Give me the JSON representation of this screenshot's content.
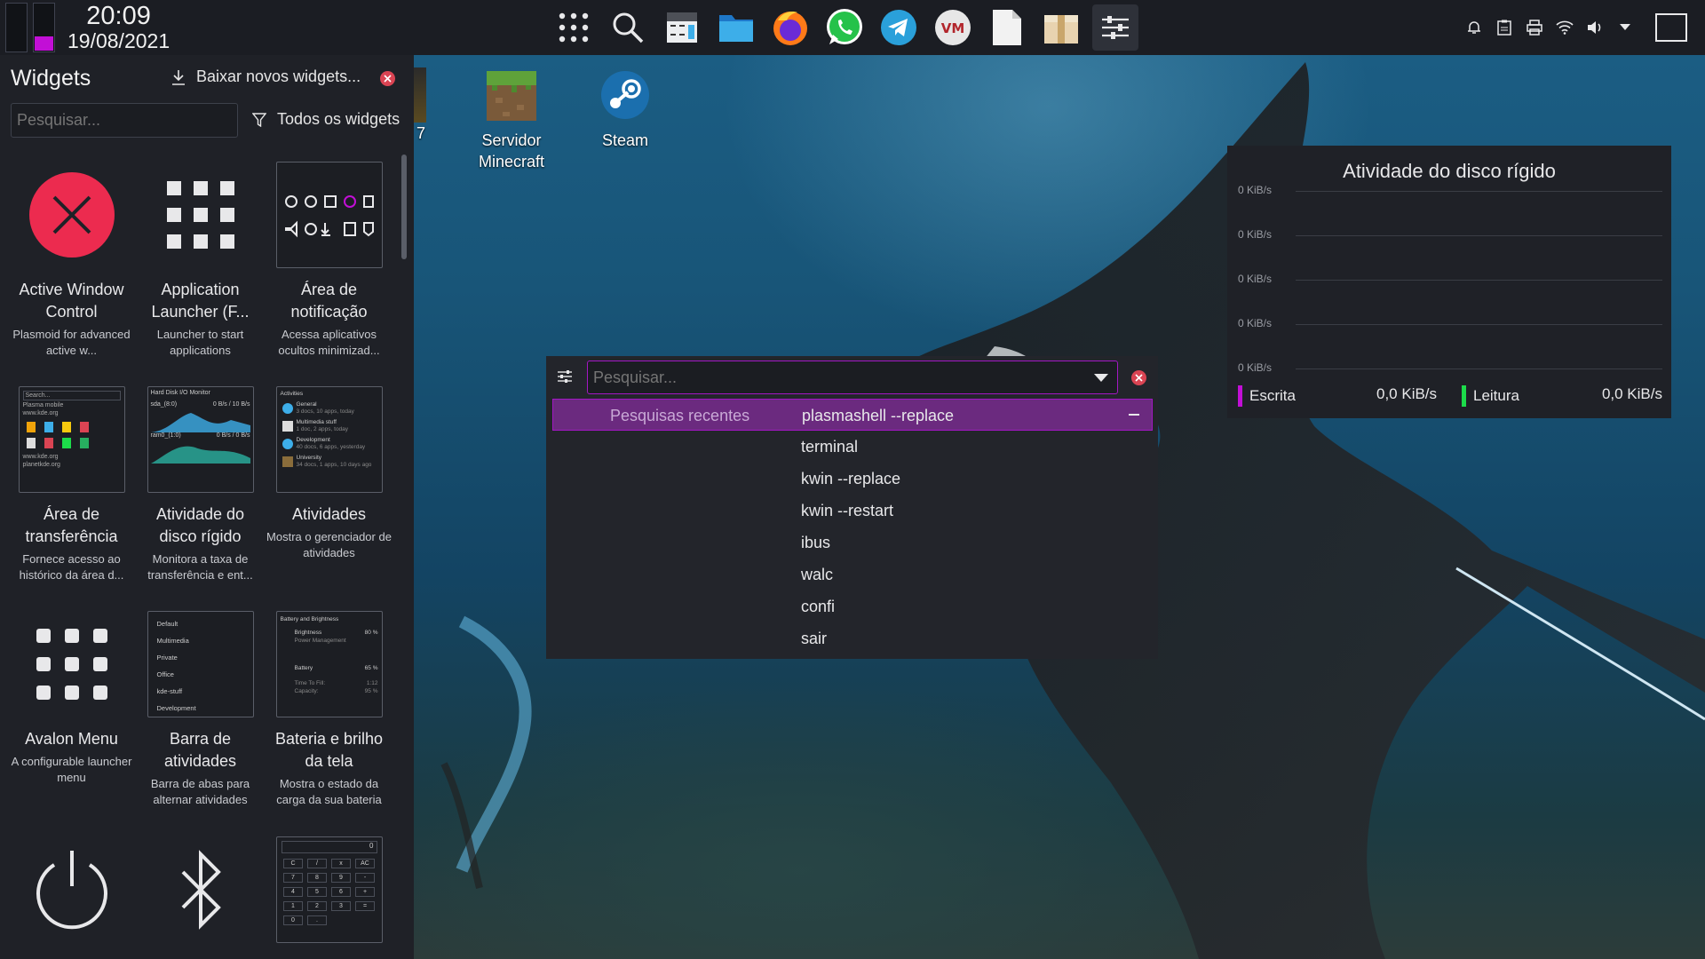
{
  "top_panel": {
    "clock": {
      "time": "20:09",
      "date": "19/08/2021"
    },
    "accent_color": "#c20fd6",
    "tasks": [
      {
        "icon": "app-grid-icon"
      },
      {
        "icon": "search-icon"
      },
      {
        "icon": "calculator-icon"
      },
      {
        "icon": "folder-icon"
      },
      {
        "icon": "firefox-icon"
      },
      {
        "icon": "whatsapp-icon"
      },
      {
        "icon": "telegram-icon"
      },
      {
        "icon": "vm-icon"
      },
      {
        "icon": "document-icon"
      },
      {
        "icon": "archive-icon"
      },
      {
        "icon": "system-settings-icon"
      }
    ],
    "tray": [
      "notifications-icon",
      "clipboard-icon",
      "printer-icon",
      "wifi-icon",
      "volume-icon",
      "expand-tray-icon"
    ]
  },
  "widgets_panel": {
    "title": "Widgets",
    "get_new": "Baixar novos widgets...",
    "search_placeholder": "Pesquisar...",
    "filter": "Todos os widgets",
    "items": [
      {
        "name": "Active Window Control",
        "desc": "Plasmoid for advanced active w..."
      },
      {
        "name": "Application Launcher (F...",
        "desc": "Launcher to start applications"
      },
      {
        "name": "Área de notificação",
        "desc": "Acessa aplicativos ocultos minimizad..."
      },
      {
        "name": "Área de transferência",
        "desc": "Fornece acesso ao histórico da área d..."
      },
      {
        "name": "Atividade do disco rígido",
        "desc": "Monitora a taxa de transferência e ent..."
      },
      {
        "name": "Atividades",
        "desc": "Mostra o gerenciador de atividades"
      },
      {
        "name": "Avalon Menu",
        "desc": "A configurable launcher menu"
      },
      {
        "name": "Barra de atividades",
        "desc": "Barra de abas para alternar atividades"
      },
      {
        "name": "Bateria e brilho da tela",
        "desc": "Mostra o estado da carga da sua bateria"
      }
    ],
    "thumbs": {
      "clipboard": {
        "search": "Search...",
        "l1": "Plasma mobile",
        "l2": "www.kde.org",
        "l3": "www.kde.org",
        "l4": "planetkde.org"
      },
      "disk": {
        "title": "Hard Disk I/O Monitor",
        "d1": "sda_(8:0)",
        "d1v": "0 B/s / 10 B/s",
        "d2": "ram0_(1:0)",
        "d2v": "0 B/s / 0 B/s"
      },
      "activities": {
        "title": "Activities",
        "a1": "General",
        "a1s": "3 docs, 10 apps, today",
        "a2": "Multimedia stuff",
        "a2s": "1 doc, 2 apps, today",
        "a3": "Development",
        "a3s": "40 docs, 6 apps, yesterday",
        "a4": "University",
        "a4s": "34 docs, 1 apps, 10 days ago"
      },
      "activity_bar": {
        "items": [
          "Default",
          "Multimedia",
          "Private",
          "Office",
          "kde-stuff",
          "Development"
        ]
      },
      "battery": {
        "title": "Battery and Brightness",
        "brightness": "Brightness",
        "brightness_v": "80 %",
        "power": "Power Management",
        "battery": "Battery",
        "battery_v": "65 %",
        "ttf": "Time To Fill:",
        "ttf_v": "1:12",
        "cap": "Capacity:",
        "cap_v": "95 %"
      },
      "calculator": {
        "display": "0",
        "keys": [
          "C",
          "/",
          "x",
          "AC",
          "7",
          "8",
          "9",
          "-",
          "4",
          "5",
          "6",
          "+",
          "1",
          "2",
          "3",
          "=",
          "0",
          "."
        ]
      }
    }
  },
  "desktop": {
    "partial_label": "7",
    "icons": [
      {
        "label": "Servidor Minecraft",
        "icon": "minecraft-grass-block-icon"
      },
      {
        "label": "Steam",
        "icon": "steam-icon"
      }
    ]
  },
  "disk_widget": {
    "title": "Atividade do disco rígido",
    "axis": [
      "0 KiB/s",
      "0 KiB/s",
      "0 KiB/s",
      "0 KiB/s",
      "0 KiB/s"
    ],
    "write_label": "Escrita",
    "write_value": "0,0 KiB/s",
    "write_color": "#c20fd6",
    "read_label": "Leitura",
    "read_value": "0,0 KiB/s",
    "read_color": "#1cdc4a"
  },
  "krunner": {
    "placeholder": "Pesquisar...",
    "category": "Pesquisas recentes",
    "results": [
      "plasmashell --replace",
      "terminal",
      "kwin --replace",
      "kwin --restart",
      "ibus",
      "walc",
      "confi",
      "sair"
    ]
  }
}
